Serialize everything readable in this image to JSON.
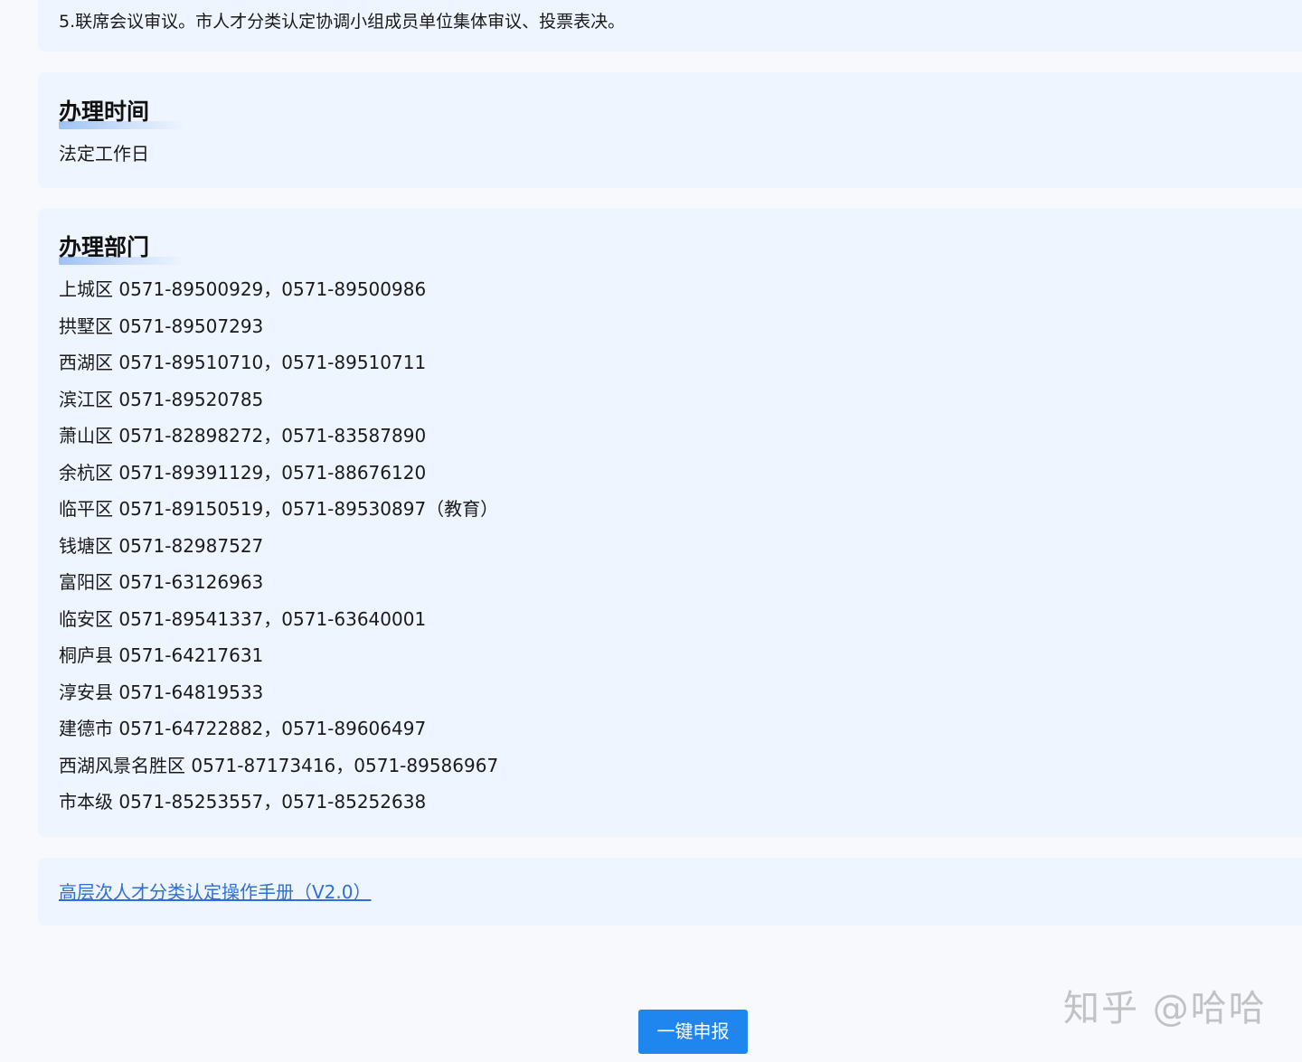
{
  "steps": {
    "last_step": "5.联席会议审议。市人才分类认定协调小组成员单位集体审议、投票表决。"
  },
  "time_section": {
    "title": "办理时间",
    "content": "法定工作日"
  },
  "dept_section": {
    "title": "办理部门",
    "items": [
      "上城区 0571-89500929，0571-89500986",
      "拱墅区 0571-89507293",
      "西湖区 0571-89510710，0571-89510711",
      "滨江区 0571-89520785",
      "萧山区 0571-82898272，0571-83587890",
      "余杭区 0571-89391129，0571-88676120",
      "临平区 0571-89150519，0571-89530897（教育）",
      "钱塘区 0571-82987527",
      "富阳区 0571-63126963",
      "临安区 0571-89541337，0571-63640001",
      "桐庐县 0571-64217631",
      "淳安县 0571-64819533",
      "建德市 0571-64722882，0571-89606497",
      "西湖风景名胜区 0571-87173416，0571-89586967",
      "市本级 0571-85253557，0571-85252638"
    ]
  },
  "manual": {
    "link_text": "高层次人才分类认定操作手册（V2.0）"
  },
  "actions": {
    "submit_label": "一键申报"
  },
  "watermark": {
    "text": "知乎 @哈哈"
  },
  "colors": {
    "card_bg": "#eef5fe",
    "page_bg": "#f7f9fd",
    "link": "#2f6fd6",
    "button": "#1f86f0"
  }
}
